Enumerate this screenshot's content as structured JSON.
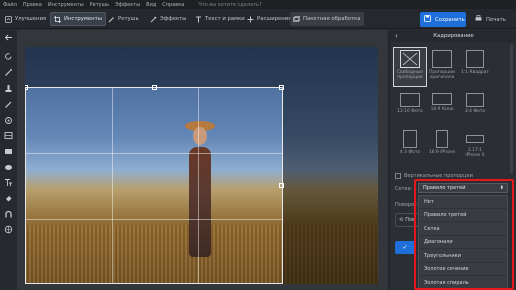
{
  "menu": [
    "Файл",
    "Правка",
    "Инструменты",
    "Ретушь",
    "Эффекты",
    "Вид",
    "Справка"
  ],
  "menu_search": "Что вы хотите сделать?",
  "toolbar": {
    "items": [
      "Улучшения",
      "Инструменты",
      "Ретушь",
      "Эффекты",
      "Текст и рамки",
      "Расширения",
      "Пакетная обработка"
    ],
    "active": "Инструменты",
    "save_label": "Сохранить",
    "print_label": "Печать"
  },
  "panel": {
    "title": "Кадрирование",
    "presets": [
      {
        "label": "Свободные пропорции",
        "selected": true
      },
      {
        "label": "Пропорции оригинала",
        "selected": false
      },
      {
        "label": "1:1 Квадрат",
        "selected": false
      },
      {
        "label": "13:10 Фото",
        "selected": false
      },
      {
        "label": "16:9 Кино",
        "selected": false
      },
      {
        "label": "3:4 Фото",
        "selected": false
      },
      {
        "label": "4:3 Фото",
        "selected": false
      },
      {
        "label": "16:9 iPhone",
        "selected": false
      },
      {
        "label": "2.17:1 iPhone X",
        "selected": false
      }
    ],
    "vertical_label": "Вертикальные пропорции",
    "grid_label": "Сетка:",
    "rotate_label": "Поворот:",
    "rotate_btn": "Пов",
    "apply_icon": "check-icon"
  },
  "grid_select": {
    "value": "Правило третей",
    "options": [
      "Нет",
      "Правило третей",
      "Сетка",
      "Диагонали",
      "Треугольники",
      "Золотое сечение",
      "Золотая спираль"
    ]
  },
  "colors": {
    "accent": "#1e6fd9",
    "highlight": "#e3191b"
  }
}
